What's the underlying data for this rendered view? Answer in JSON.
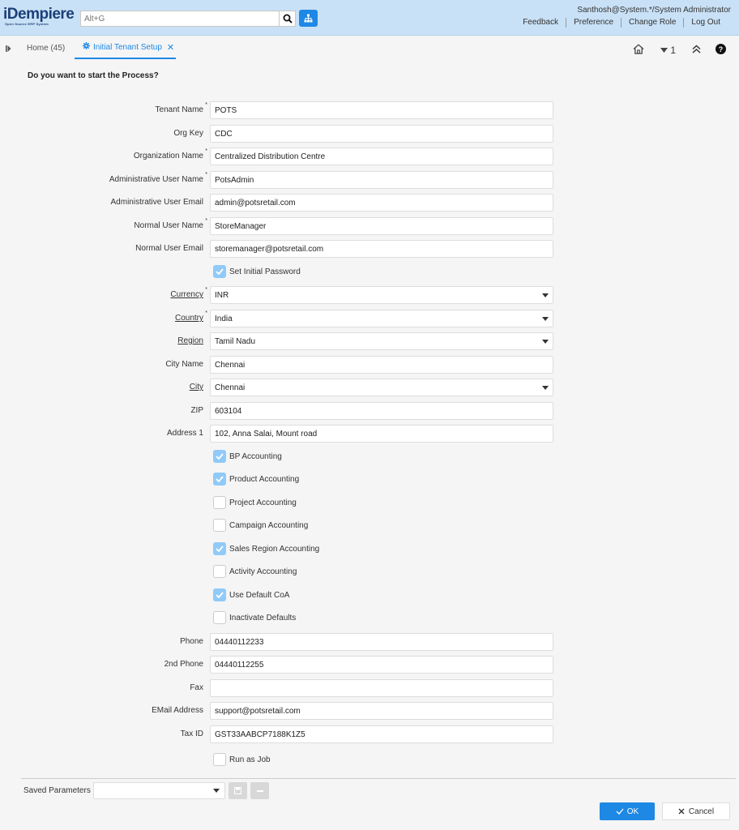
{
  "header": {
    "logo_main": "iDempiere",
    "logo_sub": "Open Source ERP System",
    "search_placeholder": "Alt+G",
    "user": "Santhosh@System.*/System Administrator",
    "links": [
      "Feedback",
      "Preference",
      "Change Role",
      "Log Out"
    ]
  },
  "tabs": {
    "home": "Home (45)",
    "active": "Initial Tenant Setup",
    "window_count": "1"
  },
  "question": "Do you want to start the Process?",
  "fields": {
    "tenant_name": {
      "label": "Tenant Name",
      "value": "POTS"
    },
    "org_key": {
      "label": "Org Key",
      "value": "CDC"
    },
    "organization_name": {
      "label": "Organization Name",
      "value": "Centralized Distribution Centre"
    },
    "admin_user_name": {
      "label": "Administrative User Name",
      "value": "PotsAdmin"
    },
    "admin_user_email": {
      "label": "Administrative User Email",
      "value": "admin@potsretail.com"
    },
    "normal_user_name": {
      "label": "Normal User Name",
      "value": "StoreManager"
    },
    "normal_user_email": {
      "label": "Normal User Email",
      "value": "storemanager@potsretail.com"
    },
    "set_initial_password": {
      "label": "Set Initial Password",
      "checked": true
    },
    "currency": {
      "label": "Currency",
      "value": "INR"
    },
    "country": {
      "label": "Country",
      "value": "India"
    },
    "region": {
      "label": "Region",
      "value": "Tamil Nadu"
    },
    "city_name": {
      "label": "City Name",
      "value": "Chennai"
    },
    "city": {
      "label": "City",
      "value": "Chennai"
    },
    "zip": {
      "label": "ZIP",
      "value": "603104"
    },
    "address1": {
      "label": "Address 1",
      "value": "102, Anna Salai, Mount road"
    },
    "bp_accounting": {
      "label": "BP Accounting",
      "checked": true
    },
    "product_accounting": {
      "label": "Product Accounting",
      "checked": true
    },
    "project_accounting": {
      "label": "Project Accounting",
      "checked": false
    },
    "campaign_accounting": {
      "label": "Campaign Accounting",
      "checked": false
    },
    "sales_region_accounting": {
      "label": "Sales Region Accounting",
      "checked": true
    },
    "activity_accounting": {
      "label": "Activity Accounting",
      "checked": false
    },
    "use_default_coa": {
      "label": "Use Default CoA",
      "checked": true
    },
    "inactivate_defaults": {
      "label": "Inactivate Defaults",
      "checked": false
    },
    "phone": {
      "label": "Phone",
      "value": "04440112233"
    },
    "phone2": {
      "label": "2nd Phone",
      "value": "04440112255"
    },
    "fax": {
      "label": "Fax",
      "value": ""
    },
    "email_address": {
      "label": "EMail Address",
      "value": "support@potsretail.com"
    },
    "tax_id": {
      "label": "Tax ID",
      "value": "GST33AABCP7188K1Z5"
    },
    "run_as_job": {
      "label": "Run as Job",
      "checked": false
    }
  },
  "footer": {
    "saved_parameters_label": "Saved Parameters",
    "ok_label": "OK",
    "cancel_label": "Cancel"
  },
  "colors": {
    "header_bg": "#c9e1f6",
    "accent": "#1e88e5",
    "checkbox_checked": "#90caf9"
  }
}
